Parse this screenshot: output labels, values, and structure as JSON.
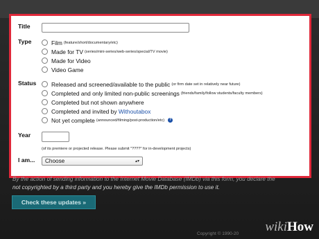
{
  "form": {
    "title_label": "Title",
    "type_label": "Type",
    "type_options": [
      {
        "label": "Film",
        "note": "(feature/short/documentary/etc)"
      },
      {
        "label": "Made for TV",
        "note": "(series/mini-series/web-series/special/TV movie)"
      },
      {
        "label": "Made for Video",
        "note": ""
      },
      {
        "label": "Video Game",
        "note": ""
      }
    ],
    "status_label": "Status",
    "status_options": [
      {
        "label": "Released and screened/available to the public",
        "note": "(or firm date set in relatively near future)"
      },
      {
        "label": "Completed and only limited non-public screenings",
        "note": "(friends/family/follow students/faculty members)"
      },
      {
        "label": "Completed but not shown anywhere",
        "note": ""
      },
      {
        "label": "Completed and invited by",
        "link": "Withoutabox",
        "note": ""
      },
      {
        "label": "Not yet complete",
        "note": "(announced/filming/post-production/etc)"
      }
    ],
    "year_label": "Year",
    "year_note": "(of its premiere or projected release. Please submit \"????\" for in-development projects)",
    "iam_label": "I am...",
    "iam_select_value": "Choose"
  },
  "legal": {
    "line1": "By the action of sending information to the Internet Movie Database (IMDb) via this form, you declare the",
    "line2": "not copyrighted by a third party and you hereby give the IMDb permission to use it."
  },
  "check_button_label": "Check these updates »",
  "footer": {
    "copyright": "Copyright © 1990-20"
  },
  "watermark": {
    "wiki": "wiki",
    "how": "How"
  }
}
